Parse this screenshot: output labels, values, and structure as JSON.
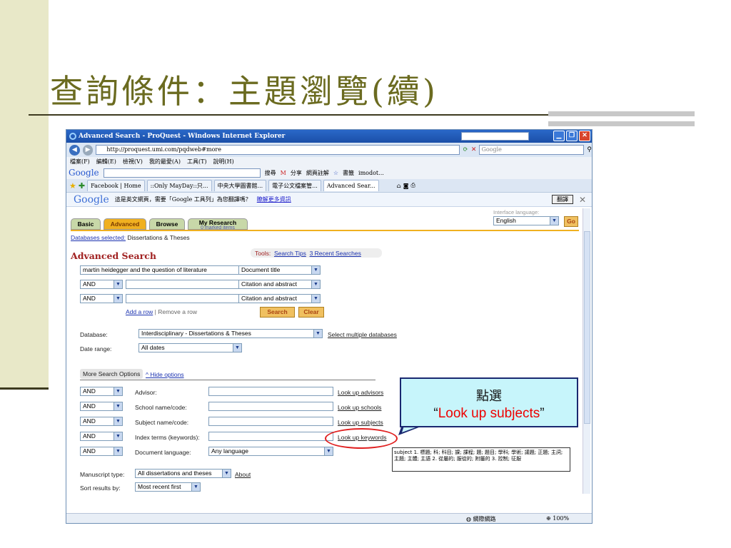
{
  "slide": {
    "title": "查詢條件：主題瀏覽(續)"
  },
  "browser": {
    "window_title": "Advanced Search - ProQuest - Windows Internet Explorer",
    "url": "http://proquest.umi.com/pqdweb#more",
    "search_placeholder": "Google",
    "menu": [
      "檔案(F)",
      "編輯(E)",
      "檢視(V)",
      "我的最愛(A)",
      "工具(T)",
      "說明(H)"
    ],
    "google_toolbar": {
      "logo": "Google",
      "items": [
        "搜尋",
        "分享",
        "網頁註解",
        "書籤",
        "imodot..."
      ]
    },
    "tabs": [
      "Facebook | Home",
      "::Only MayDay::只...",
      "中央大學圖書館...",
      "電子公文檔案管...",
      "Advanced Sear..."
    ],
    "translate_bar": {
      "logo": "Google",
      "message": "這是英文網頁，需要「Google 工具列」為您翻譯嗎？",
      "link": "瞭解更多資訊",
      "button": "翻譯"
    },
    "status": {
      "zone": "網際網路",
      "zoom": "100%"
    }
  },
  "proquest": {
    "tabs": [
      "Basic",
      "Advanced",
      "Browse",
      "My Research"
    ],
    "my_research_sub": "0 marked items",
    "interface_language_label": "Interface language:",
    "interface_language": "English",
    "go": "Go",
    "databases_selected_link": "Databases selected:",
    "databases_selected_value": "Dissertations & Theses",
    "heading": "Advanced Search",
    "tools_label": "Tools:",
    "search_tips": "Search Tips",
    "recent_searches": "3 Recent Searches",
    "rows": [
      {
        "op": "",
        "term": "martin heidegger and the question of literature",
        "field": "Document title"
      },
      {
        "op": "AND",
        "term": "",
        "field": "Citation and abstract"
      },
      {
        "op": "AND",
        "term": "",
        "field": "Citation and abstract"
      }
    ],
    "add_row": "Add a row",
    "remove_row": "| Remove a row",
    "search_btn": "Search",
    "clear_btn": "Clear",
    "database_label": "Database:",
    "database_value": "Interdisciplinary - Dissertations & Theses",
    "select_multiple": "Select multiple databases",
    "date_label": "Date range:",
    "date_value": "All dates",
    "more_options_tab": "More Search Options",
    "hide_options": "^ Hide options",
    "more_rows": [
      {
        "op": "AND",
        "label": "Advisor:",
        "link": "Look up advisors"
      },
      {
        "op": "AND",
        "label": "School name/code:",
        "link": "Look up schools"
      },
      {
        "op": "AND",
        "label": "Subject name/code:",
        "link": "Look up subjects"
      },
      {
        "op": "AND",
        "label": "Index terms (keywords):",
        "link": "Look up keywords"
      },
      {
        "op": "AND",
        "label": "Document language:",
        "select": "Any language"
      }
    ],
    "manuscript_label": "Manuscript type:",
    "manuscript_value": "All dissertations and theses",
    "about": "About",
    "sort_label": "Sort results by:",
    "sort_value": "Most recent first"
  },
  "callout": {
    "line1": "點選",
    "line2_prefix": "“",
    "line2": "Look up subjects",
    "line2_suffix": "”"
  },
  "tooltip": {
    "text": "subject 1. 標題; 科; 科目; 課; 課程; 題; 題目; 學科; 學術; 議題; 正題; 主詞; 主題; 主體; 主語 2. 從屬的; 服從的; 附屬的 3. 控制; 征服"
  }
}
